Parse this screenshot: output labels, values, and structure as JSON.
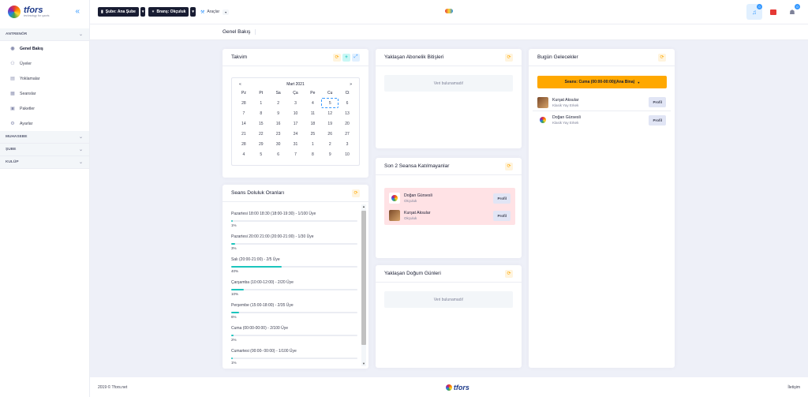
{
  "brand": {
    "name": "tfors",
    "tagline": "technology for sports"
  },
  "sidebar": {
    "sections": [
      {
        "label": "ANTRENÖR",
        "items": [
          {
            "label": "Genel Bakış",
            "icon": "eye-icon"
          },
          {
            "label": "Üyeler",
            "icon": "users-icon"
          },
          {
            "label": "Yoklamalar",
            "icon": "clipboard-icon"
          },
          {
            "label": "Seanslar",
            "icon": "calendar-icon"
          },
          {
            "label": "Paketler",
            "icon": "package-icon"
          },
          {
            "label": "Ayarlar",
            "icon": "gear-icon"
          }
        ]
      },
      {
        "label": "MUHASEBE"
      },
      {
        "label": "ŞUBE"
      },
      {
        "label": "KULÜP"
      }
    ]
  },
  "topbar": {
    "branch_label": "Şube: Ana Şube",
    "discipline_label": "Branş: Okçuluk",
    "tools_label": "Araçlar",
    "notif_count": "0",
    "user_count": "0"
  },
  "page": {
    "title": "Genel Bakış"
  },
  "calendar": {
    "title": "Takvim",
    "month": "Mart 2021",
    "prev": "«",
    "next": "»",
    "weekdays": [
      "Pz",
      "Pt",
      "Sa",
      "Ça",
      "Pe",
      "Cu",
      "Ct"
    ],
    "days": [
      "28",
      "1",
      "2",
      "3",
      "4",
      "5",
      "6",
      "7",
      "8",
      "9",
      "10",
      "11",
      "12",
      "13",
      "14",
      "15",
      "16",
      "17",
      "18",
      "19",
      "20",
      "21",
      "22",
      "23",
      "24",
      "25",
      "26",
      "27",
      "28",
      "29",
      "30",
      "31",
      "1",
      "2",
      "3",
      "4",
      "5",
      "6",
      "7",
      "8",
      "9",
      "10"
    ],
    "today": "5"
  },
  "occupancy": {
    "title": "Seans Doluluk Oranları",
    "items": [
      {
        "label": "Pazartesi 18:00 18:30 (18:00-19:30) - 1/100 Üye",
        "pct": "1%",
        "value": 1
      },
      {
        "label": "Pazartesi 20:00 21:00 (20:00-21:00) - 1/30 Üye",
        "pct": "3%",
        "value": 3
      },
      {
        "label": "Salı (20:00-21:00) - 2/5 Üye",
        "pct": "40%",
        "value": 40
      },
      {
        "label": "Çarşamba (10:00-12:00) - 2/20 Üye",
        "pct": "10%",
        "value": 10
      },
      {
        "label": "Perşembe (15:00-18:00) - 2/35 Üye",
        "pct": "6%",
        "value": 6
      },
      {
        "label": "Cuma (00:00-00:00) - 2/100 Üye",
        "pct": "2%",
        "value": 2
      },
      {
        "label": "Cumartesi (00:00- 00:00) - 1/100 Üye",
        "pct": "1%",
        "value": 1
      }
    ]
  },
  "subscriptions": {
    "title": "Yaklaşan Abonelik Bitişleri",
    "empty": "Veri bulunamadı!"
  },
  "absent": {
    "title": "Son 2 Seansa Katılmayanlar",
    "people": [
      {
        "name": "Doğan Gürsesli",
        "sub": "Okçuluk",
        "avatar": "logo"
      },
      {
        "name": "Kurşat Aksular",
        "sub": "Okçuluk",
        "avatar": "photo"
      }
    ],
    "profile_label": "Profil"
  },
  "birthdays": {
    "title": "Yaklaşan Doğum Günleri",
    "empty": "Veri bulunamadı!"
  },
  "today": {
    "title": "Bugün Gelecekler",
    "session_label": "Seans: Cuma (00:00-00:00)(Ana Bina)",
    "people": [
      {
        "name": "Kurşat Aksular",
        "sub": "Klasik Yay Erkek",
        "avatar": "photo"
      },
      {
        "name": "Doğan Gürsesli",
        "sub": "Klasik Yay Erkek",
        "avatar": "logo"
      }
    ],
    "profile_label": "Profil"
  },
  "footer": {
    "copyright": "2019 © Tfors.net",
    "logo": "tfors",
    "link": "İletişim"
  }
}
